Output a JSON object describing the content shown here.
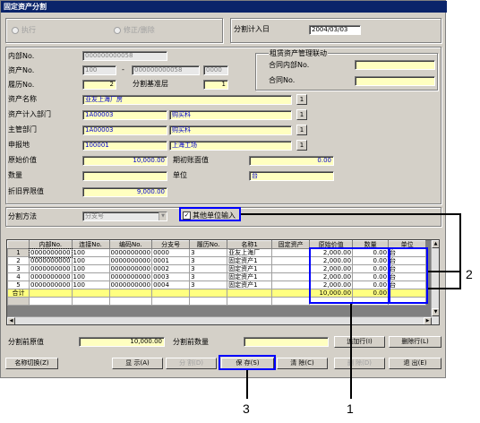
{
  "window": {
    "title": "固定资产分割"
  },
  "mode": {
    "execute_label": "执行",
    "modify_label": "修正/删除"
  },
  "split_date": {
    "label": "分割计入日",
    "value": "2004/03/03"
  },
  "form": {
    "internal_no": {
      "label": "内部No.",
      "value": "000000000058"
    },
    "asset_no": {
      "label": "资产No.",
      "v1": "100",
      "dash": "-",
      "v2": "000000000058",
      "v3": "0000"
    },
    "history_no": {
      "label": "履历No.",
      "value": "2"
    },
    "split_base_level": {
      "label": "分割基准层",
      "value": "1"
    },
    "asset_name": {
      "label": "资产名称",
      "value": "亚友上海厂房"
    },
    "asset_dept": {
      "label": "资产计入部门",
      "code": "1A00003",
      "name": "购买科"
    },
    "main_dept": {
      "label": "主管部门",
      "code": "1A00003",
      "name": "购买科"
    },
    "declare_place": {
      "label": "申报地",
      "code": "100001",
      "name": "上海工场"
    },
    "original_value": {
      "label": "原始价值",
      "value": "10,000.00"
    },
    "period_start_book": {
      "label": "期初账面值",
      "value": "0.00"
    },
    "quantity": {
      "label": "数量",
      "value": ""
    },
    "unit": {
      "label": "单位",
      "value": "台"
    },
    "depreciation_limit": {
      "label": "折旧界限值",
      "value": "9,000.00"
    },
    "lookup_label": "1"
  },
  "lease": {
    "title": "租赁资产管理联动",
    "contract_internal_no": {
      "label": "合同内部No.",
      "value": ""
    },
    "contract_no": {
      "label": "合同No.",
      "value": ""
    }
  },
  "split_method": {
    "label": "分割方法",
    "value": "分支号"
  },
  "other_unit_input": {
    "label": "其他单位输入",
    "checked": true
  },
  "grid": {
    "columns": [
      "",
      "内部No.",
      "连接No.",
      "编码No.",
      "分支号",
      "履历No.",
      "名称1",
      "固定资产",
      "原始价值",
      "数量",
      "单位"
    ],
    "rows": [
      {
        "rn": "1",
        "internal": "0000000000",
        "link": "100",
        "code": "0000000000",
        "branch": "0000",
        "history": "3",
        "name": "亚友上海厂",
        "fixed": "",
        "value": "2,000.00",
        "qty": "0.00",
        "unit": "台"
      },
      {
        "rn": "2",
        "internal": "0000000000",
        "link": "100",
        "code": "0000000000",
        "branch": "0001",
        "history": "3",
        "name": "固定资产1",
        "fixed": "",
        "value": "2,000.00",
        "qty": "0.00",
        "unit": "台"
      },
      {
        "rn": "3",
        "internal": "0000000000",
        "link": "100",
        "code": "0000000000",
        "branch": "0002",
        "history": "3",
        "name": "固定资产1",
        "fixed": "",
        "value": "2,000.00",
        "qty": "0.00",
        "unit": "台"
      },
      {
        "rn": "4",
        "internal": "0000000000",
        "link": "100",
        "code": "0000000000",
        "branch": "0003",
        "history": "3",
        "name": "固定资产1",
        "fixed": "",
        "value": "2,000.00",
        "qty": "0.00",
        "unit": "台"
      },
      {
        "rn": "5",
        "internal": "0000000000",
        "link": "100",
        "code": "0000000000",
        "branch": "0004",
        "history": "3",
        "name": "固定资产1",
        "fixed": "",
        "value": "2,000.00",
        "qty": "0.00",
        "unit": "台"
      }
    ],
    "total": {
      "label": "合计",
      "value": "10,000.00",
      "qty": "0.00"
    }
  },
  "footer": {
    "pre_original": {
      "label": "分割前原值",
      "value": "10,000.00"
    },
    "pre_quantity": {
      "label": "分割前数量",
      "value": ""
    },
    "add_row": "追加行(I)",
    "delete_row": "删除行(L)"
  },
  "buttons": {
    "name_switch": "名称切换(Z)",
    "display": "显 示(A)",
    "split": "分 割(D)",
    "save": "保 存(S)",
    "clear": "清 除(C)",
    "delete": "删 除(D)",
    "exit": "退 出(E)"
  },
  "callouts": {
    "c1": "1",
    "c2": "2",
    "c3": "3"
  }
}
